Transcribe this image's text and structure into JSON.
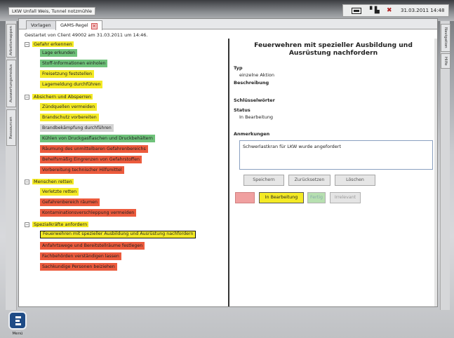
{
  "window_title": "LKW Unfall Weis, Tunnel notzmühle",
  "status": {
    "datetime": "31.03.2011 14:48",
    "battery": "battery-icon",
    "signal": "signal-icon",
    "alert": "close-icon"
  },
  "left_tabs": [
    "Arbeitsmappen",
    "Auswertungsmodus",
    "Ressourcen"
  ],
  "right_tabs": [
    "Navigation",
    "Hilfe"
  ],
  "tabs": [
    {
      "label": "Vorlagen"
    },
    {
      "label": "GAMS-Regel"
    }
  ],
  "started_text": "Gestartet von Client 49002 am 31.03.2011 um 14:46.",
  "colors": {
    "yellow": "#f4ea25",
    "green": "#6fc27a",
    "red": "#ec5b3d",
    "gray": "#d4d4d4"
  },
  "groups": [
    {
      "label": "Gefahr erkennen",
      "color": "yellow",
      "items": [
        {
          "label": "Lage erkunden",
          "color": "green"
        },
        {
          "label": "Stoff-Informationen einholen",
          "color": "green"
        },
        {
          "label": "Freisetzung feststellen",
          "color": "yellow"
        },
        {
          "label": "Lagemeldung durchführen",
          "color": "yellow"
        }
      ]
    },
    {
      "label": "Absichern und Absperren",
      "color": "yellow",
      "items": [
        {
          "label": "Zündquellen vermeiden",
          "color": "yellow"
        },
        {
          "label": "Brandschutz vorbereiten",
          "color": "yellow"
        },
        {
          "label": "Brandbekämpfung durchführen",
          "color": "gray"
        },
        {
          "label": "Kühlen von Druckgasflaschen und Druckbehältern",
          "color": "green"
        },
        {
          "label": "Räumung des unmittelbaren Gefahrenbereichs",
          "color": "red"
        },
        {
          "label": "Behelfsmäßig Eingrenzen von Gefahrstoffen",
          "color": "red"
        },
        {
          "label": "Vorbereitung technischer Hilfsmittel",
          "color": "red"
        }
      ]
    },
    {
      "label": "Menschen retten",
      "color": "yellow",
      "items": [
        {
          "label": "Verletzte retten",
          "color": "yellow"
        },
        {
          "label": "Gefahrenbereich räumen",
          "color": "red"
        },
        {
          "label": "Kontaminationsverschleppung vermeiden",
          "color": "red"
        }
      ]
    },
    {
      "label": "Spezialkräfte anfordern",
      "color": "yellow",
      "items": [
        {
          "label": "Feuerwehren mit spezieller Ausbildung und Ausrüstung nachfordern",
          "color": "yellow",
          "selected": true
        },
        {
          "label": "Anfahrtswege und Bereitstellräume festlegen",
          "color": "red"
        },
        {
          "label": "Fachbehörden verständigen lassen",
          "color": "red"
        },
        {
          "label": "Sachkundige Personen beiziehen",
          "color": "red"
        }
      ]
    }
  ],
  "detail": {
    "title_line1": "Feuerwehren mit spezieller Ausbildung und",
    "title_line2": "Ausrüstung nachfordern",
    "typ_label": "Typ",
    "typ_value": "einzelne Aktion",
    "beschreibung_label": "Beschreibung",
    "schluessel_label": "Schlüsselwörter",
    "status_label": "Status",
    "status_value": "In Bearbeitung",
    "anmerkungen_label": "Anmerkungen",
    "anmerkungen_value": "Schwerlastkran für LKW wurde angefordert",
    "buttons": {
      "save": "Speichern",
      "reset": "Zurücksetzen",
      "delete": "Löschen"
    },
    "states": {
      "red": "",
      "in_progress": "In Bearbeitung",
      "done": "Fertig",
      "irrelevant": "Irrelevant"
    }
  },
  "menu_label": "Menü"
}
